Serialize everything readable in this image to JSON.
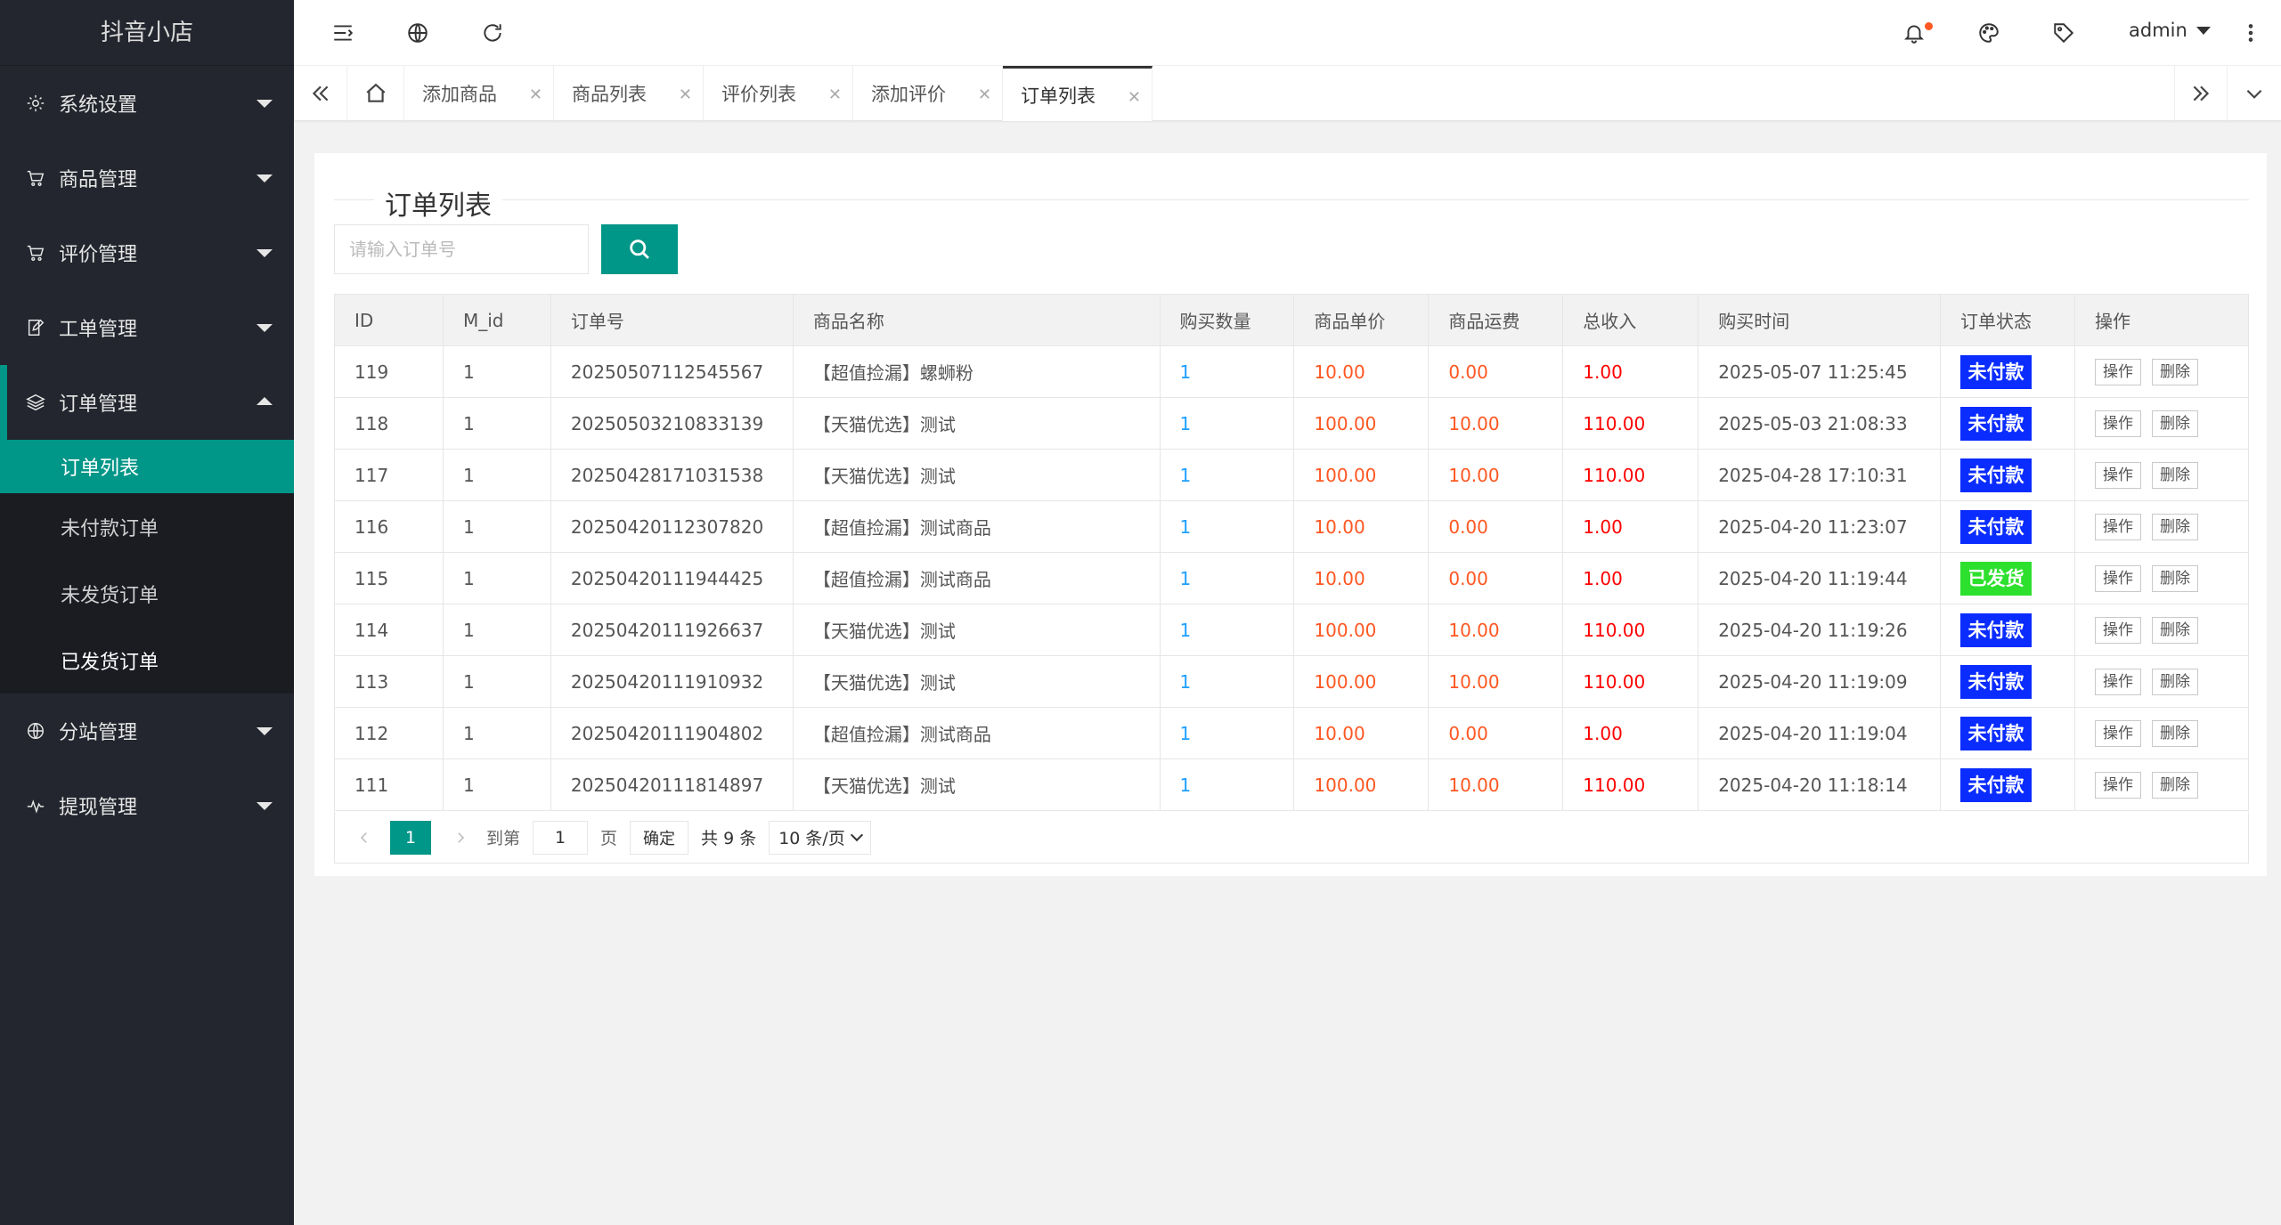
{
  "app": {
    "title": "抖音小店"
  },
  "sidebar": {
    "items": [
      {
        "label": "系统设置",
        "icon": "gear-icon"
      },
      {
        "label": "商品管理",
        "icon": "cart-icon"
      },
      {
        "label": "评价管理",
        "icon": "cart-icon"
      },
      {
        "label": "工单管理",
        "icon": "edit-icon"
      },
      {
        "label": "订单管理",
        "icon": "layers-icon"
      },
      {
        "label": "分站管理",
        "icon": "globe-icon"
      },
      {
        "label": "提现管理",
        "icon": "pulse-icon"
      }
    ],
    "submenu": [
      "订单列表",
      "未付款订单",
      "未发货订单",
      "已发货订单"
    ]
  },
  "header": {
    "user": "admin"
  },
  "tabs": [
    "添加商品",
    "商品列表",
    "评价列表",
    "添加评价",
    "订单列表"
  ],
  "page": {
    "title": "订单列表",
    "search_placeholder": "请输入订单号"
  },
  "table": {
    "columns": [
      "ID",
      "M_id",
      "订单号",
      "商品名称",
      "购买数量",
      "商品单价",
      "商品运费",
      "总收入",
      "购买时间",
      "订单状态",
      "操作"
    ],
    "op_label": "操作",
    "delete_label": "删除",
    "rows": [
      {
        "id": "119",
        "mid": "1",
        "order_no": "20250507112545567",
        "name": "【超值捡漏】螺蛳粉",
        "qty": "1",
        "price": "10.00",
        "freight": "0.00",
        "total": "1.00",
        "time": "2025-05-07 11:25:45",
        "status": "未付款",
        "status_color": "#0a2cff"
      },
      {
        "id": "118",
        "mid": "1",
        "order_no": "20250503210833139",
        "name": "【天猫优选】测试",
        "qty": "1",
        "price": "100.00",
        "freight": "10.00",
        "total": "110.00",
        "time": "2025-05-03 21:08:33",
        "status": "未付款",
        "status_color": "#0a2cff"
      },
      {
        "id": "117",
        "mid": "1",
        "order_no": "20250428171031538",
        "name": "【天猫优选】测试",
        "qty": "1",
        "price": "100.00",
        "freight": "10.00",
        "total": "110.00",
        "time": "2025-04-28 17:10:31",
        "status": "未付款",
        "status_color": "#0a2cff"
      },
      {
        "id": "116",
        "mid": "1",
        "order_no": "20250420112307820",
        "name": "【超值捡漏】测试商品",
        "qty": "1",
        "price": "10.00",
        "freight": "0.00",
        "total": "1.00",
        "time": "2025-04-20 11:23:07",
        "status": "未付款",
        "status_color": "#0a2cff"
      },
      {
        "id": "115",
        "mid": "1",
        "order_no": "20250420111944425",
        "name": "【超值捡漏】测试商品",
        "qty": "1",
        "price": "10.00",
        "freight": "0.00",
        "total": "1.00",
        "time": "2025-04-20 11:19:44",
        "status": "已发货",
        "status_color": "#2ee02e"
      },
      {
        "id": "114",
        "mid": "1",
        "order_no": "20250420111926637",
        "name": "【天猫优选】测试",
        "qty": "1",
        "price": "100.00",
        "freight": "10.00",
        "total": "110.00",
        "time": "2025-04-20 11:19:26",
        "status": "未付款",
        "status_color": "#0a2cff"
      },
      {
        "id": "113",
        "mid": "1",
        "order_no": "20250420111910932",
        "name": "【天猫优选】测试",
        "qty": "1",
        "price": "100.00",
        "freight": "10.00",
        "total": "110.00",
        "time": "2025-04-20 11:19:09",
        "status": "未付款",
        "status_color": "#0a2cff"
      },
      {
        "id": "112",
        "mid": "1",
        "order_no": "20250420111904802",
        "name": "【超值捡漏】测试商品",
        "qty": "1",
        "price": "10.00",
        "freight": "0.00",
        "total": "1.00",
        "time": "2025-04-20 11:19:04",
        "status": "未付款",
        "status_color": "#0a2cff"
      },
      {
        "id": "111",
        "mid": "1",
        "order_no": "20250420111814897",
        "name": "【天猫优选】测试",
        "qty": "1",
        "price": "100.00",
        "freight": "10.00",
        "total": "110.00",
        "time": "2025-04-20 11:18:14",
        "status": "未付款",
        "status_color": "#0a2cff"
      }
    ]
  },
  "pagination": {
    "current": "1",
    "goto_label": "到第",
    "goto_value": "1",
    "page_label": "页",
    "confirm_label": "确定",
    "total_label": "共 9 条",
    "page_size": "10 条/页"
  },
  "colors": {
    "accent": "#009688",
    "sidebar_bg": "#23262e"
  }
}
